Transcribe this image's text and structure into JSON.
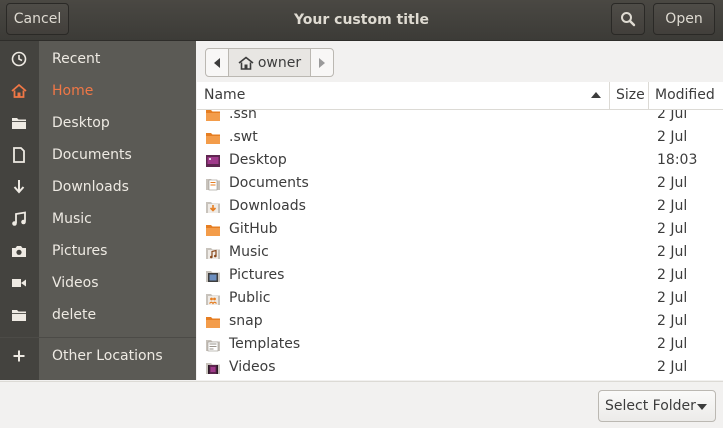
{
  "header": {
    "title": "Your custom title",
    "cancel_label": "Cancel",
    "open_label": "Open",
    "search_icon": "search-icon"
  },
  "sidebar": {
    "items": [
      {
        "label": "Recent",
        "icon": "clock-icon"
      },
      {
        "label": "Home",
        "icon": "home-icon",
        "active": true
      },
      {
        "label": "Desktop",
        "icon": "folder-icon"
      },
      {
        "label": "Documents",
        "icon": "document-icon"
      },
      {
        "label": "Downloads",
        "icon": "download-icon"
      },
      {
        "label": "Music",
        "icon": "music-icon"
      },
      {
        "label": "Pictures",
        "icon": "camera-icon"
      },
      {
        "label": "Videos",
        "icon": "video-icon"
      },
      {
        "label": "delete",
        "icon": "folder-icon"
      },
      {
        "label": "Other Locations",
        "icon": "plus-icon"
      }
    ],
    "accent_color": "#f07746"
  },
  "pathbar": {
    "crumb": "owner"
  },
  "columns": {
    "name": "Name",
    "size": "Size",
    "modified": "Modified"
  },
  "files": [
    {
      "name": ".ssh",
      "modified": "2 Jul",
      "icon": "folder-icon"
    },
    {
      "name": ".swt",
      "modified": "2 Jul",
      "icon": "folder-icon"
    },
    {
      "name": "Desktop",
      "modified": "18:03",
      "icon": "desktop-folder-icon"
    },
    {
      "name": "Documents",
      "modified": "2 Jul",
      "icon": "documents-folder-icon"
    },
    {
      "name": "Downloads",
      "modified": "2 Jul",
      "icon": "downloads-folder-icon"
    },
    {
      "name": "GitHub",
      "modified": "2 Jul",
      "icon": "folder-icon"
    },
    {
      "name": "Music",
      "modified": "2 Jul",
      "icon": "music-folder-icon"
    },
    {
      "name": "Pictures",
      "modified": "2 Jul",
      "icon": "pictures-folder-icon"
    },
    {
      "name": "Public",
      "modified": "2 Jul",
      "icon": "public-folder-icon"
    },
    {
      "name": "snap",
      "modified": "2 Jul",
      "icon": "folder-icon"
    },
    {
      "name": "Templates",
      "modified": "2 Jul",
      "icon": "templates-folder-icon"
    },
    {
      "name": "Videos",
      "modified": "2 Jul",
      "icon": "videos-folder-icon"
    }
  ],
  "footer": {
    "select_label": "Select Folder"
  }
}
